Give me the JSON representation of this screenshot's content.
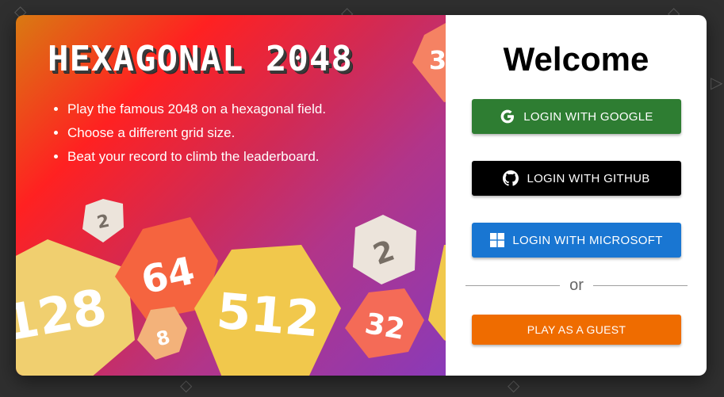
{
  "game": {
    "title": "HEXAGONAL 2048",
    "features": [
      "Play the famous 2048 on a hexagonal field.",
      "Choose a different grid size.",
      "Beat your record to climb the leaderboard."
    ],
    "tiles": [
      "128",
      "64",
      "2",
      "8",
      "512",
      "2",
      "32",
      "3"
    ]
  },
  "login": {
    "welcome": "Welcome",
    "google_label": "LOGIN WITH GOOGLE",
    "github_label": "LOGIN WITH GITHUB",
    "microsoft_label": "LOGIN WITH MICROSOFT",
    "or_label": "or",
    "guest_label": "PLAY AS A GUEST"
  },
  "icons": {
    "google": "google-icon",
    "github": "github-icon",
    "microsoft": "microsoft-icon"
  },
  "colors": {
    "google_button": "#2e7d32",
    "github_button": "#000000",
    "microsoft_button": "#1976d2",
    "guest_button": "#ef6c00",
    "tile_128": "#f0cf6f",
    "tile_64": "#f5643f",
    "tile_2": "#ece4db",
    "tile_8": "#f3b27a",
    "tile_512": "#f1c84c",
    "tile_32": "#f46b57"
  }
}
